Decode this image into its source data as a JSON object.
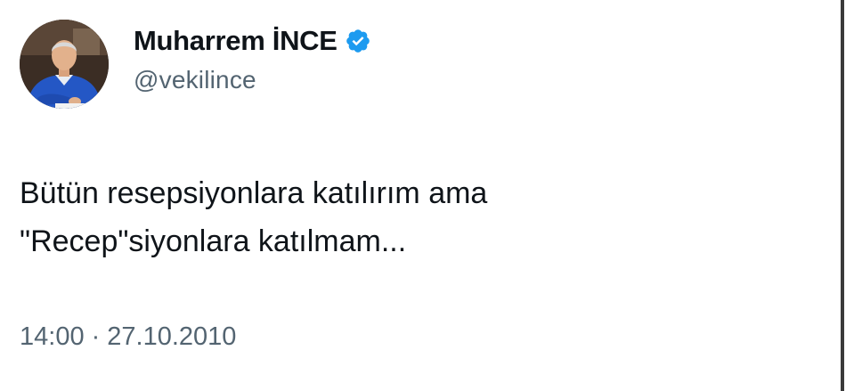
{
  "author": {
    "display_name": "Muharrem İNCE",
    "handle": "@vekilince",
    "verified": true,
    "verified_color": "#1d9bf0",
    "avatar_icon": "profile-photo"
  },
  "tweet": {
    "text": "Bütün resepsiyonlara katılırım ama\n\"Recep\"siyonlara katılmam...",
    "time": "14:00",
    "separator": "·",
    "date": "27.10.2010"
  },
  "colors": {
    "text_primary": "#0f1419",
    "text_secondary": "#536471",
    "background": "#ffffff"
  }
}
